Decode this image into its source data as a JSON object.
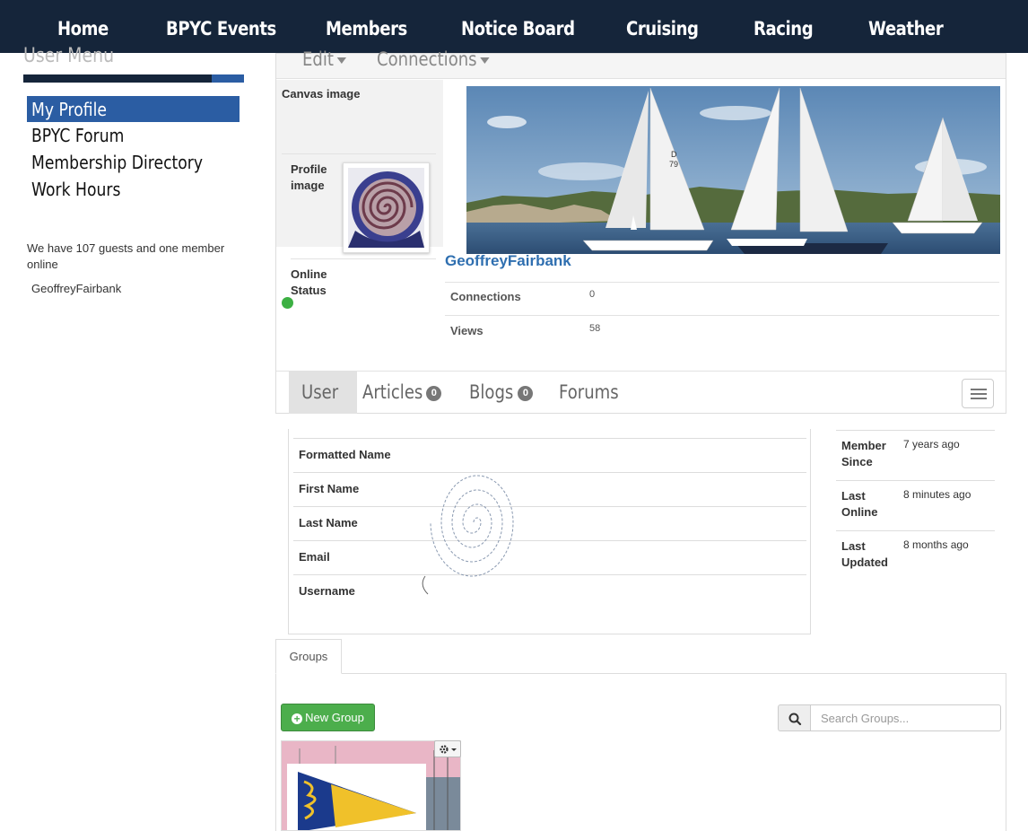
{
  "nav": [
    "Home",
    "BPYC Events",
    "Members",
    "Notice Board",
    "Cruising",
    "Racing",
    "Weather"
  ],
  "sidebar": {
    "title": "User Menu",
    "items": [
      "My Profile",
      "BPYC Forum",
      "Membership Directory",
      "Work Hours"
    ],
    "active_item": "My Profile",
    "online_text": "We have 107 guests and one member online",
    "online_member": "GeoffreyFairbank"
  },
  "profile": {
    "menu": {
      "edit": "Edit",
      "connections": "Connections"
    },
    "canvas_label": "Canvas image",
    "profile_image_label": "Profile image",
    "online_status_label": "Online Status",
    "display_name": "GeoffreyFairbank",
    "stats": [
      {
        "label": "Connections",
        "value": "0"
      },
      {
        "label": "Views",
        "value": "58"
      }
    ],
    "status_color": "#3cb043"
  },
  "tabs": [
    {
      "label": "User",
      "badge": null
    },
    {
      "label": "Articles",
      "badge": "0"
    },
    {
      "label": "Blogs",
      "badge": "0"
    },
    {
      "label": "Forums",
      "badge": null
    }
  ],
  "details": {
    "fields": [
      "Formatted Name",
      "First Name",
      "Last Name",
      "Email",
      "Username"
    ],
    "meta": [
      {
        "label": "Member Since",
        "value": "7 years ago"
      },
      {
        "label": "Last Online",
        "value": "8 minutes ago"
      },
      {
        "label": "Last Updated",
        "value": "8 months ago"
      }
    ]
  },
  "groups": {
    "tab_label": "Groups",
    "new_button": "New Group",
    "search_placeholder": "Search Groups..."
  },
  "colors": {
    "nav_bg": "#15253a",
    "accent": "#2b5da3",
    "success": "#4cae4c",
    "link": "#2f6fb0"
  },
  "icons": [
    "caret-down-icon",
    "hamburger-menu-icon",
    "search-icon",
    "plus-circle-icon",
    "gear-icon"
  ]
}
